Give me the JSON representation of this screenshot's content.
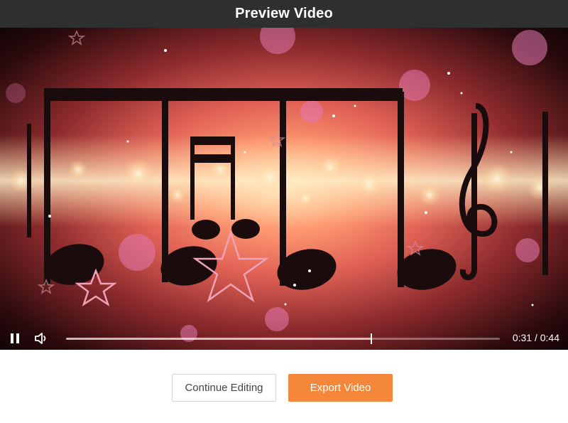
{
  "dialog": {
    "title": "Preview Video"
  },
  "player": {
    "state": "playing",
    "pause_icon": "pause-icon",
    "volume_icon": "volume-icon",
    "current_time": "0:31",
    "total_time": "0:44",
    "time_display": "0:31 / 0:44",
    "progress_fraction": 0.7045
  },
  "actions": {
    "continue_label": "Continue Editing",
    "export_label": "Export Video"
  },
  "colors": {
    "title_bar": "#2f2f2f",
    "export_button": "#f5873a",
    "page_background": "#ffffff"
  }
}
